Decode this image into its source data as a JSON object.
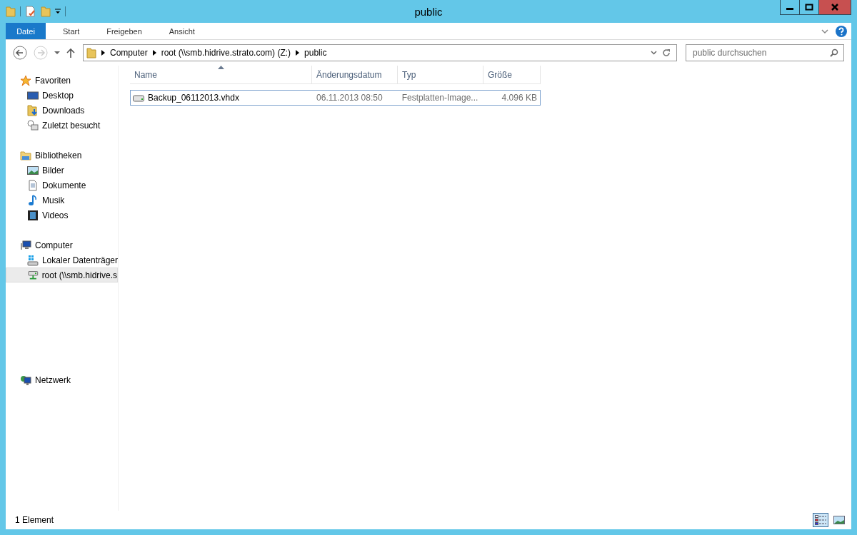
{
  "window": {
    "title": "public"
  },
  "ribbon_tabs": [
    {
      "label": "Datei",
      "kind": "file"
    },
    {
      "label": "Start",
      "kind": "tab"
    },
    {
      "label": "Freigeben",
      "kind": "tab"
    },
    {
      "label": "Ansicht",
      "kind": "tab"
    }
  ],
  "address": {
    "segments": [
      "Computer",
      "root (\\\\smb.hidrive.strato.com) (Z:)",
      "public"
    ]
  },
  "search": {
    "placeholder": "public durchsuchen"
  },
  "sidebar": {
    "groups": [
      {
        "label": "Favoriten",
        "kind": "star",
        "selected": false,
        "children": [
          {
            "label": "Desktop",
            "kind": "desktop",
            "selected": false
          },
          {
            "label": "Downloads",
            "kind": "downloads",
            "selected": false
          },
          {
            "label": "Zuletzt besucht",
            "kind": "recent",
            "selected": false
          }
        ]
      },
      {
        "label": "Bibliotheken",
        "kind": "library",
        "selected": false,
        "children": [
          {
            "label": "Bilder",
            "kind": "pictures",
            "selected": false
          },
          {
            "label": "Dokumente",
            "kind": "documents",
            "selected": false
          },
          {
            "label": "Musik",
            "kind": "music",
            "selected": false
          },
          {
            "label": "Videos",
            "kind": "videos",
            "selected": false
          }
        ]
      },
      {
        "label": "Computer",
        "kind": "computer",
        "selected": false,
        "children": [
          {
            "label": "Lokaler Datenträger",
            "kind": "localdisk",
            "selected": false
          },
          {
            "label": "root (\\\\smb.hidrive.s",
            "kind": "netdrive",
            "selected": true
          }
        ]
      },
      {
        "label": "Netzwerk",
        "kind": "network",
        "selected": false
      }
    ]
  },
  "table": {
    "columns": [
      {
        "label": "Name",
        "sorted": true
      },
      {
        "label": "Änderungsdatum",
        "sorted": false
      },
      {
        "label": "Typ",
        "sorted": false
      },
      {
        "label": "Größe",
        "sorted": false
      }
    ],
    "rows": [
      {
        "name": "Backup_06112013.vhdx",
        "date": "06.11.2013 08:50",
        "type": "Festplatten-Image...",
        "size": "4.096 KB",
        "focused": true
      }
    ]
  },
  "status_bar": {
    "text": "1 Element",
    "view_buttons": [
      {
        "kind": "details",
        "selected": true
      },
      {
        "kind": "tiles",
        "selected": false
      }
    ]
  }
}
